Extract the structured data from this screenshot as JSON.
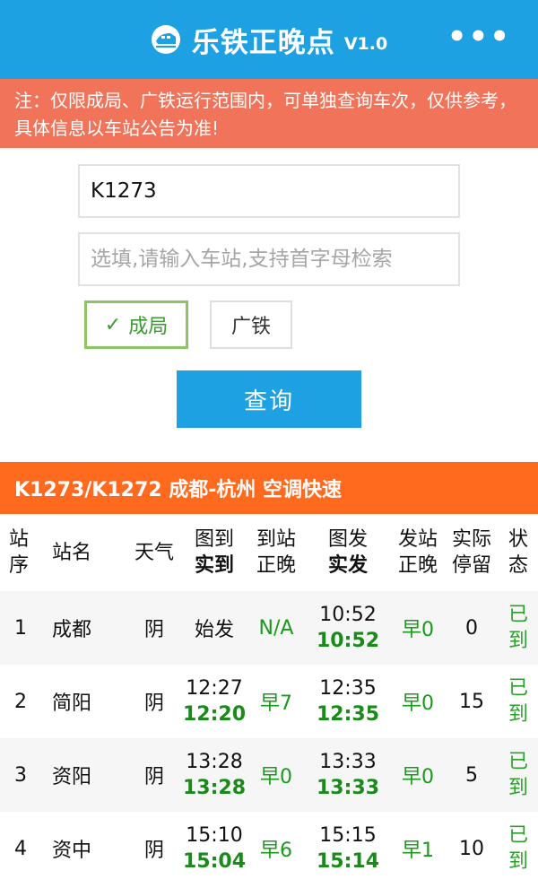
{
  "header": {
    "title": "乐铁正晚点",
    "version": "V1.0",
    "menu": "•••",
    "logo_icon": "train-icon"
  },
  "notice": "注：仅限成局、广铁运行范围内，可单独查询车次，仅供参考，具体信息以车站公告为准!",
  "form": {
    "train_value": "K1273",
    "station_placeholder": "选填,请输入车站,支持首字母检索",
    "options": [
      {
        "label": "成局",
        "checked": true
      },
      {
        "label": "广铁",
        "checked": false
      }
    ],
    "query_label": "查询"
  },
  "train": {
    "title": "K1273/K1272 成都-杭州 空调快速"
  },
  "table": {
    "headers": {
      "seq": [
        "站",
        "序"
      ],
      "name": "站名",
      "weather": "天气",
      "arr": [
        "图到",
        "实到"
      ],
      "arr_delay": [
        "到站",
        "正晚"
      ],
      "dep": [
        "图发",
        "实发"
      ],
      "dep_delay": [
        "发站",
        "正晚"
      ],
      "stay": [
        "实际",
        "停留"
      ],
      "status": [
        "状",
        "态"
      ]
    },
    "rows": [
      {
        "seq": "1",
        "name": "成都",
        "weather": "阴",
        "arr_sched": "始发",
        "arr_actual": "",
        "arr_delay": "N/A",
        "dep_sched": "10:52",
        "dep_actual": "10:52",
        "dep_delay": "早0",
        "stay": "0",
        "status": [
          "已",
          "到"
        ]
      },
      {
        "seq": "2",
        "name": "简阳",
        "weather": "阴",
        "arr_sched": "12:27",
        "arr_actual": "12:20",
        "arr_delay": "早7",
        "dep_sched": "12:35",
        "dep_actual": "12:35",
        "dep_delay": "早0",
        "stay": "15",
        "status": [
          "已",
          "到"
        ]
      },
      {
        "seq": "3",
        "name": "资阳",
        "weather": "阴",
        "arr_sched": "13:28",
        "arr_actual": "13:28",
        "arr_delay": "早0",
        "dep_sched": "13:33",
        "dep_actual": "13:33",
        "dep_delay": "早0",
        "stay": "5",
        "status": [
          "已",
          "到"
        ]
      },
      {
        "seq": "4",
        "name": "资中",
        "weather": "阴",
        "arr_sched": "15:10",
        "arr_actual": "15:04",
        "arr_delay": "早6",
        "dep_sched": "15:15",
        "dep_actual": "15:14",
        "dep_delay": "早1",
        "stay": "10",
        "status": [
          "已",
          "到"
        ]
      }
    ]
  },
  "colors": {
    "header_bg": "#1ea1e3",
    "notice_bg": "#f0735a",
    "banner_bg": "#ff6a1e",
    "green": "#1a9a1a",
    "checked_border": "#8cc46a"
  }
}
